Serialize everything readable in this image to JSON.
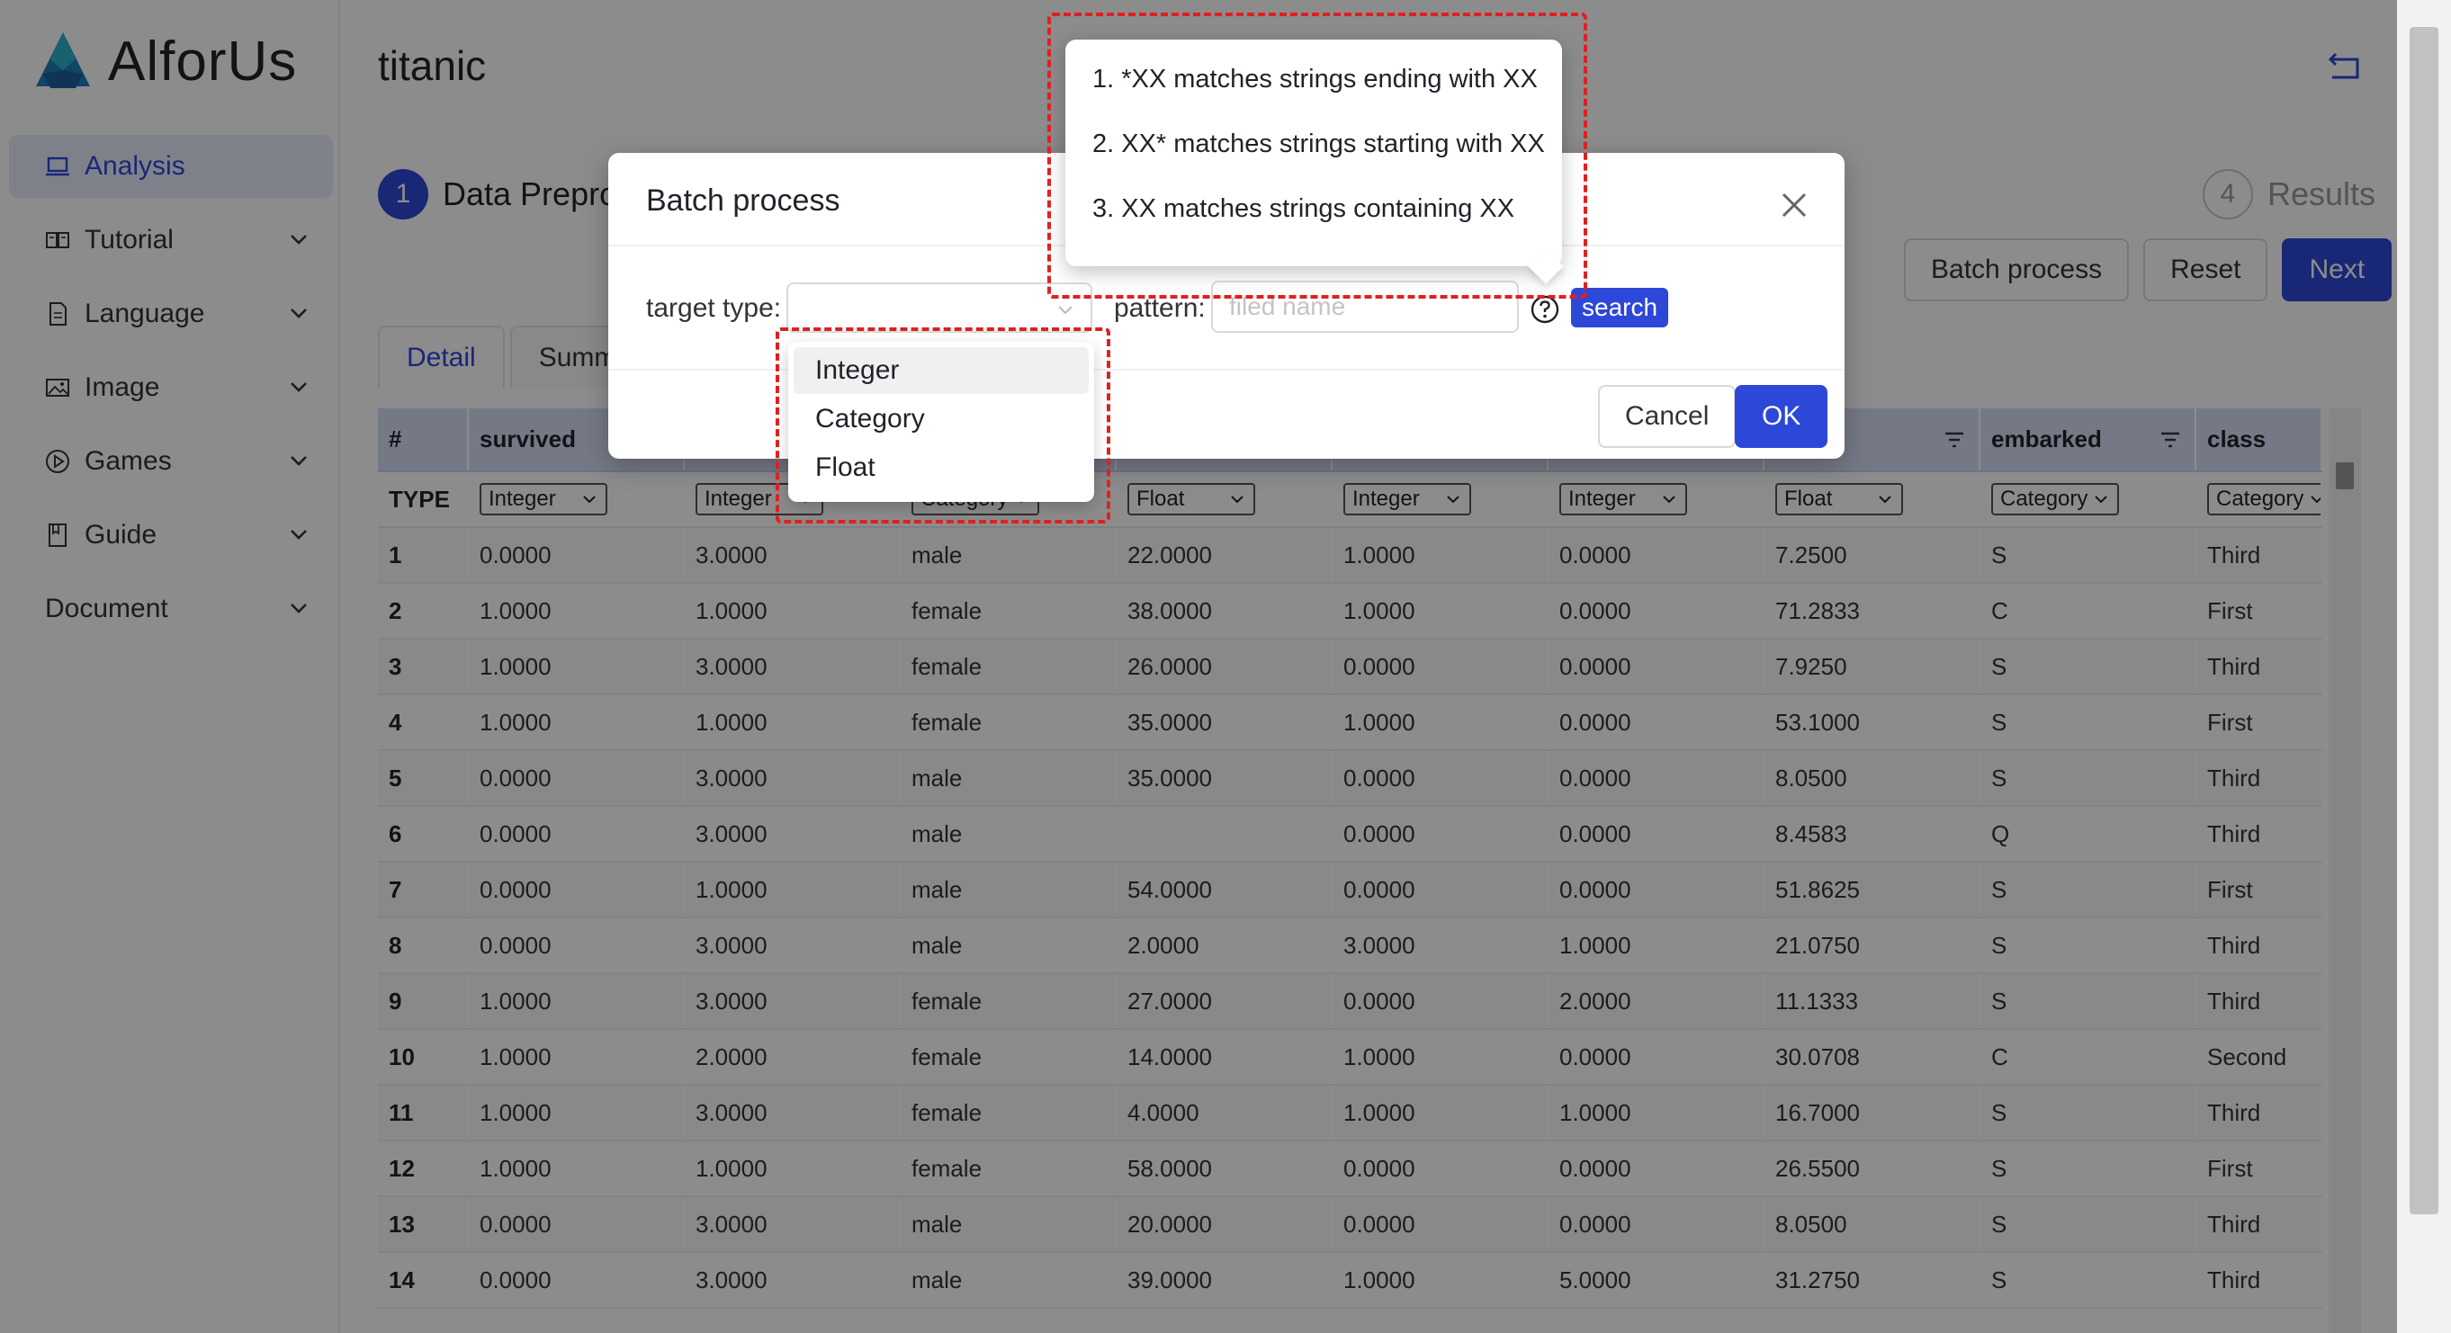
{
  "app": {
    "logo_text": "AlforUs",
    "accent": "#2d48d8"
  },
  "sidebar": {
    "items": [
      {
        "label": "Analysis",
        "icon": "laptop-icon"
      },
      {
        "label": "Tutorial",
        "icon": "book-icon"
      },
      {
        "label": "Language",
        "icon": "document-icon"
      },
      {
        "label": "Image",
        "icon": "image-icon"
      },
      {
        "label": "Games",
        "icon": "play-icon"
      },
      {
        "label": "Guide",
        "icon": "bookmark-icon"
      },
      {
        "label": "Document",
        "icon": ""
      }
    ]
  },
  "page": {
    "title": "titanic"
  },
  "steps": {
    "step1_num": "1",
    "step1_label": "Data Preproc",
    "step4_num": "4",
    "step4_label": "Results"
  },
  "actions": {
    "batch_process": "Batch process",
    "reset": "Reset",
    "next": "Next"
  },
  "tabs": [
    "Detail",
    "Summa"
  ],
  "table": {
    "headers": [
      "#",
      "survived",
      "",
      "",
      "",
      "",
      "",
      "",
      "embarked",
      "class"
    ],
    "type_label": "TYPE",
    "types": [
      "Integer",
      "Integer",
      "Category",
      "Float",
      "Integer",
      "Integer",
      "Float",
      "Category",
      "Category"
    ],
    "rows": [
      [
        "1",
        "0.0000",
        "3.0000",
        "male",
        "22.0000",
        "1.0000",
        "0.0000",
        "7.2500",
        "S",
        "Third"
      ],
      [
        "2",
        "1.0000",
        "1.0000",
        "female",
        "38.0000",
        "1.0000",
        "0.0000",
        "71.2833",
        "C",
        "First"
      ],
      [
        "3",
        "1.0000",
        "3.0000",
        "female",
        "26.0000",
        "0.0000",
        "0.0000",
        "7.9250",
        "S",
        "Third"
      ],
      [
        "4",
        "1.0000",
        "1.0000",
        "female",
        "35.0000",
        "1.0000",
        "0.0000",
        "53.1000",
        "S",
        "First"
      ],
      [
        "5",
        "0.0000",
        "3.0000",
        "male",
        "35.0000",
        "0.0000",
        "0.0000",
        "8.0500",
        "S",
        "Third"
      ],
      [
        "6",
        "0.0000",
        "3.0000",
        "male",
        "",
        "0.0000",
        "0.0000",
        "8.4583",
        "Q",
        "Third"
      ],
      [
        "7",
        "0.0000",
        "1.0000",
        "male",
        "54.0000",
        "0.0000",
        "0.0000",
        "51.8625",
        "S",
        "First"
      ],
      [
        "8",
        "0.0000",
        "3.0000",
        "male",
        "2.0000",
        "3.0000",
        "1.0000",
        "21.0750",
        "S",
        "Third"
      ],
      [
        "9",
        "1.0000",
        "3.0000",
        "female",
        "27.0000",
        "0.0000",
        "2.0000",
        "11.1333",
        "S",
        "Third"
      ],
      [
        "10",
        "1.0000",
        "2.0000",
        "female",
        "14.0000",
        "1.0000",
        "0.0000",
        "30.0708",
        "C",
        "Second"
      ],
      [
        "11",
        "1.0000",
        "3.0000",
        "female",
        "4.0000",
        "1.0000",
        "1.0000",
        "16.7000",
        "S",
        "Third"
      ],
      [
        "12",
        "1.0000",
        "1.0000",
        "female",
        "58.0000",
        "0.0000",
        "0.0000",
        "26.5500",
        "S",
        "First"
      ],
      [
        "13",
        "0.0000",
        "3.0000",
        "male",
        "20.0000",
        "0.0000",
        "0.0000",
        "8.0500",
        "S",
        "Third"
      ],
      [
        "14",
        "0.0000",
        "3.0000",
        "male",
        "39.0000",
        "1.0000",
        "5.0000",
        "31.2750",
        "S",
        "Third"
      ]
    ]
  },
  "modal": {
    "title": "Batch process",
    "target_type_label": "target type:",
    "pattern_label": "pattern:",
    "pattern_placeholder": "filed name",
    "search_label": "search",
    "cancel_label": "Cancel",
    "ok_label": "OK"
  },
  "dropdown": {
    "options": [
      "Integer",
      "Category",
      "Float"
    ]
  },
  "tooltip": {
    "lines": [
      "1. *XX matches strings ending with XX",
      "2. XX* matches strings starting with XX",
      "3. XX matches strings containing XX"
    ]
  }
}
